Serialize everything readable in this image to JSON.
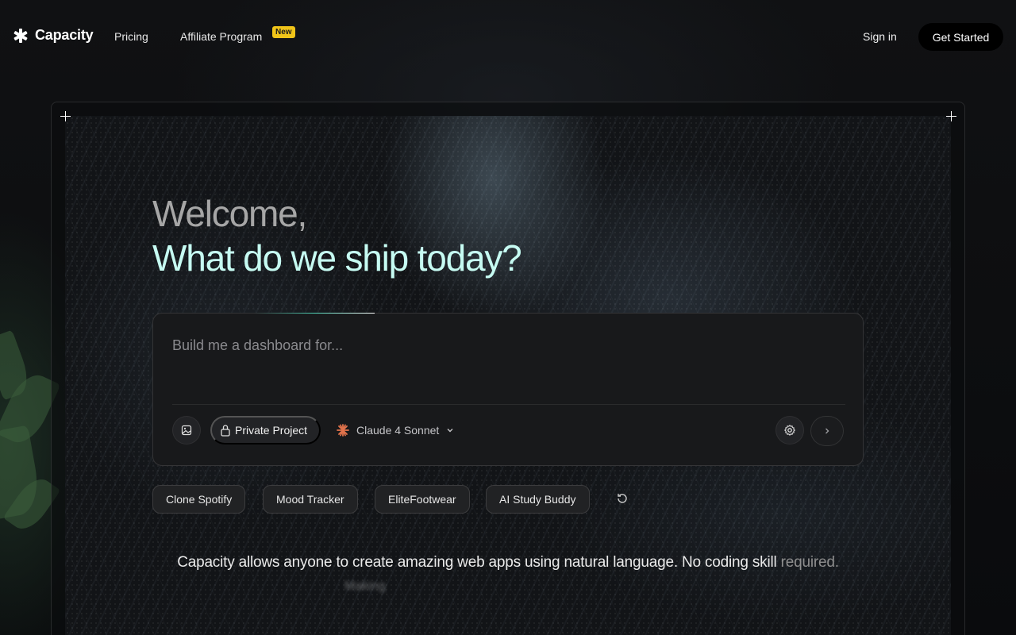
{
  "nav": {
    "brand": "Capacity",
    "links": [
      {
        "label": "Pricing"
      },
      {
        "label": "Affiliate Program",
        "badge": "New"
      }
    ],
    "sign_in": "Sign in",
    "get_started": "Get Started"
  },
  "hero": {
    "welcome": "Welcome,",
    "tagline": "What do we ship today?"
  },
  "prompt": {
    "placeholder": "Build me a dashboard for...",
    "value": "",
    "private_label": "Private Project",
    "model": "Claude 4 Sonnet",
    "icons": [
      "image-icon",
      "lock-icon",
      "claude-sparkle-icon",
      "chevron-down-icon",
      "gear-icon",
      "chevron-right-icon"
    ]
  },
  "suggestions": [
    {
      "label": "Clone Spotify"
    },
    {
      "label": "Mood Tracker"
    },
    {
      "label": "EliteFootwear"
    },
    {
      "label": "AI Study Buddy"
    }
  ],
  "footer": {
    "description_main": "Capacity allows anyone to create amazing web apps using natural language. No coding skill",
    "description_fade": " required.",
    "blur_text": "Making"
  },
  "colors": {
    "accent": "#c6fbf2",
    "badge": "#f0c419",
    "background": "#0b0c0e"
  }
}
